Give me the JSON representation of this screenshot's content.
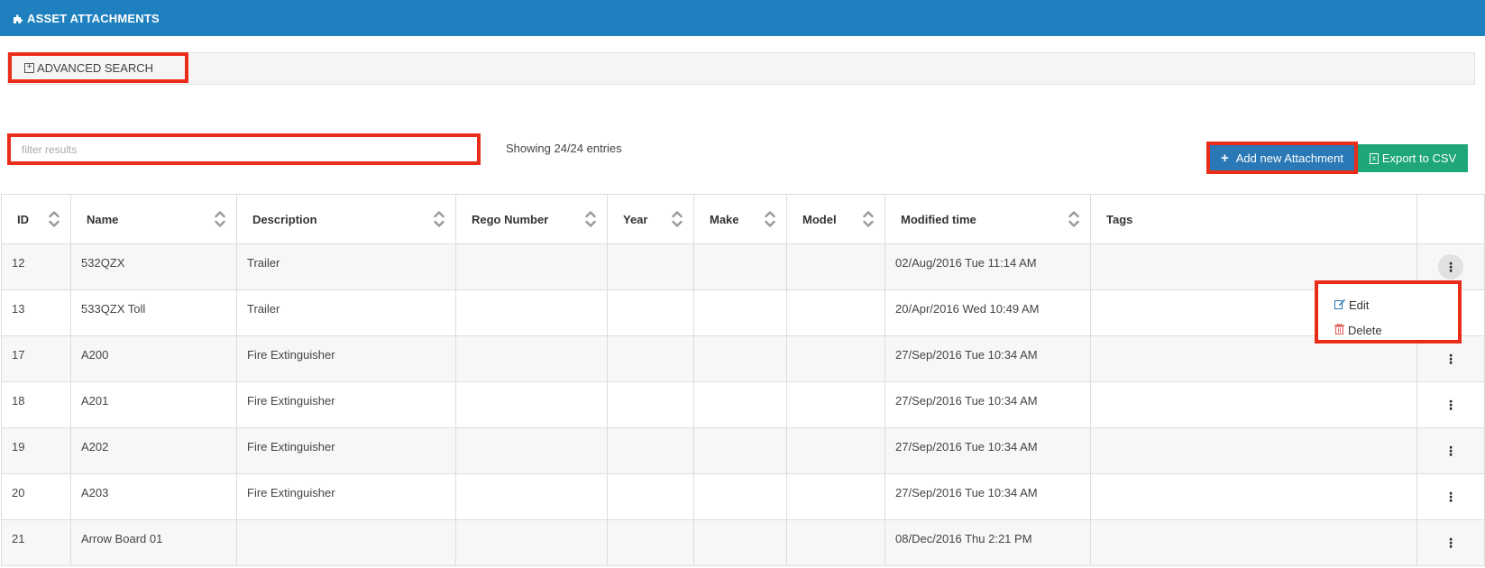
{
  "header": {
    "title": "ASSET ATTACHMENTS",
    "icon": "puzzle-icon"
  },
  "advanced_search": {
    "label": "ADVANCED SEARCH",
    "icon": "plus-square-icon"
  },
  "filter": {
    "placeholder": "filter results",
    "value": ""
  },
  "entries": {
    "text": "Showing 24/24 entries"
  },
  "toolbar": {
    "add_label": "Add new Attachment",
    "export_label": "Export to CSV"
  },
  "table": {
    "columns": [
      "ID",
      "Name",
      "Description",
      "Rego Number",
      "Year",
      "Make",
      "Model",
      "Modified time",
      "Tags"
    ],
    "rows": [
      {
        "id": "12",
        "name": "532QZX",
        "description": "Trailer",
        "rego": "",
        "year": "",
        "make": "",
        "model": "",
        "modified": "02/Aug/2016 Tue 11:14 AM",
        "tags": ""
      },
      {
        "id": "13",
        "name": "533QZX Toll",
        "description": "Trailer",
        "rego": "",
        "year": "",
        "make": "",
        "model": "",
        "modified": "20/Apr/2016 Wed 10:49 AM",
        "tags": ""
      },
      {
        "id": "17",
        "name": "A200",
        "description": "Fire Extinguisher",
        "rego": "",
        "year": "",
        "make": "",
        "model": "",
        "modified": "27/Sep/2016 Tue 10:34 AM",
        "tags": ""
      },
      {
        "id": "18",
        "name": "A201",
        "description": "Fire Extinguisher",
        "rego": "",
        "year": "",
        "make": "",
        "model": "",
        "modified": "27/Sep/2016 Tue 10:34 AM",
        "tags": ""
      },
      {
        "id": "19",
        "name": "A202",
        "description": "Fire Extinguisher",
        "rego": "",
        "year": "",
        "make": "",
        "model": "",
        "modified": "27/Sep/2016 Tue 10:34 AM",
        "tags": ""
      },
      {
        "id": "20",
        "name": "A203",
        "description": "Fire Extinguisher",
        "rego": "",
        "year": "",
        "make": "",
        "model": "",
        "modified": "27/Sep/2016 Tue 10:34 AM",
        "tags": ""
      },
      {
        "id": "21",
        "name": "Arrow Board 01",
        "description": "",
        "rego": "",
        "year": "",
        "make": "",
        "model": "",
        "modified": "08/Dec/2016 Thu 2:21 PM",
        "tags": ""
      }
    ]
  },
  "row_menu": {
    "edit_label": "Edit",
    "delete_label": "Delete"
  },
  "colors": {
    "header_bg": "#1f80bf",
    "add_btn": "#2a78b6",
    "export_btn": "#1fa67a",
    "highlight": "#ea2c1a"
  }
}
